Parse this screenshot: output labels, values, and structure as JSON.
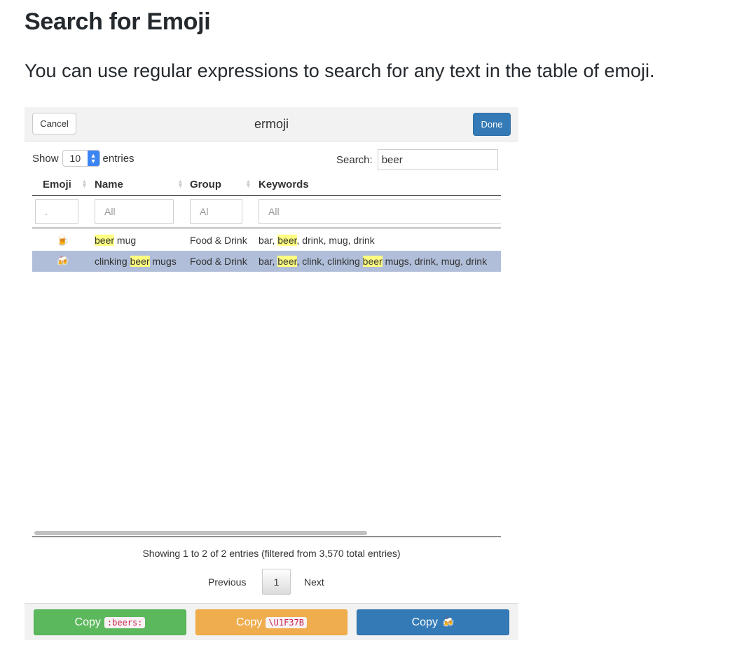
{
  "heading": "Search for Emoji",
  "intro": "You can use regular expressions to search for any text in the table of emoji.",
  "app": {
    "title": "ermoji",
    "cancel_label": "Cancel",
    "done_label": "Done",
    "show_label": "Show",
    "entries_label": "entries",
    "page_length": "10",
    "search_label": "Search:",
    "search_value": "beer",
    "columns": [
      "Emoji",
      "Name",
      "Group",
      "Keywords"
    ],
    "filters": [
      ".",
      "All",
      "Al",
      "All"
    ],
    "rows": [
      {
        "emoji": "🍺",
        "name_parts": [
          "",
          "beer",
          " mug"
        ],
        "group": "Food & Drink",
        "keyword_parts": [
          "bar, ",
          "beer",
          ", drink, mug, drink"
        ]
      },
      {
        "emoji": "🍻",
        "name_parts": [
          "clinking ",
          "beer",
          " mugs"
        ],
        "group": "Food & Drink",
        "keyword_parts": [
          "bar, ",
          "beer",
          ", clink, clinking ",
          "beer",
          " mugs, drink, mug, drink"
        ]
      }
    ],
    "info": "Showing 1 to 2 of 2 entries (filtered from 3,570 total entries)",
    "pager": {
      "previous": "Previous",
      "current": "1",
      "next": "Next"
    },
    "copy_buttons": [
      {
        "label": "Copy",
        "code": ":beers:"
      },
      {
        "label": "Copy",
        "code": "\\U1F37B"
      },
      {
        "label": "Copy",
        "emoji": "🍻"
      }
    ],
    "colors": {
      "primary": "#337ab7",
      "success": "#5cb85c",
      "warning": "#f0ad4e",
      "highlight": "#ffff80",
      "selected_row": "#b0bed9"
    }
  }
}
